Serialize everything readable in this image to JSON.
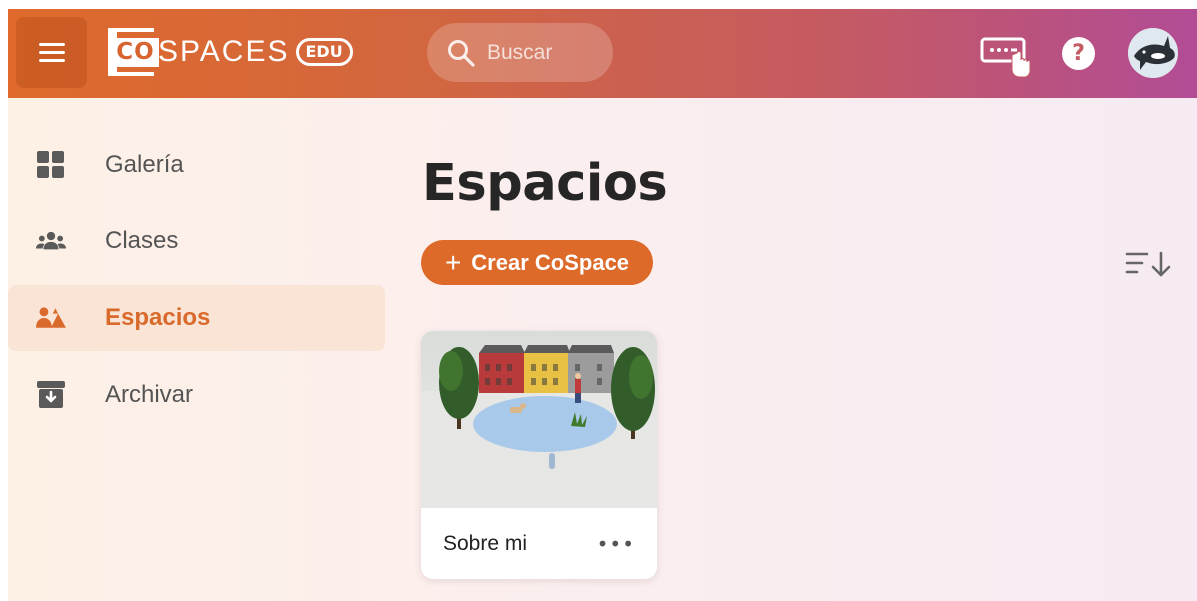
{
  "header": {
    "logo": {
      "co": "CO",
      "spaces": "SPACES",
      "edu": "EDU"
    },
    "search": {
      "placeholder": "Buscar"
    },
    "icons": [
      "menu-icon",
      "search-icon",
      "keyboard-pointer-icon",
      "help-icon",
      "avatar-orca"
    ],
    "help_label": "?"
  },
  "sidebar": {
    "items": [
      {
        "label": "Galería",
        "icon": "grid-icon",
        "active": false
      },
      {
        "label": "Clases",
        "icon": "people-icon",
        "active": false
      },
      {
        "label": "Espacios",
        "icon": "spaces-icon",
        "active": true
      },
      {
        "label": "Archivar",
        "icon": "archive-icon",
        "active": false
      }
    ]
  },
  "main": {
    "title": "Espacios",
    "create_button": {
      "plus": "+",
      "label": "Crear CoSpace"
    },
    "sort_icon": "sort-descending-icon",
    "cards": [
      {
        "name": "Sobre mi",
        "more": "•••"
      }
    ]
  },
  "colors": {
    "accent": "#de6a29",
    "active_bg": "#f9e4d6",
    "header_start": "#df6a2b",
    "header_end": "#b24c95"
  }
}
